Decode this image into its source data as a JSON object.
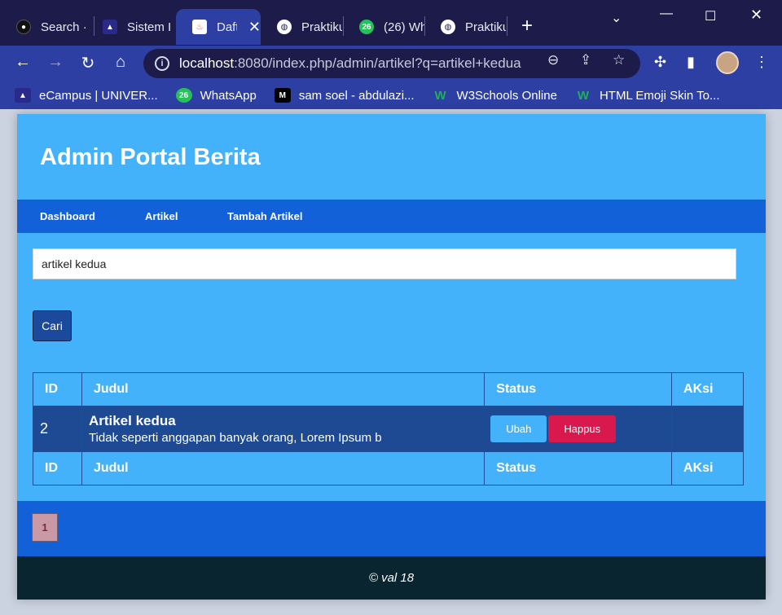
{
  "browser": {
    "tabs": [
      {
        "title": "Search ·",
        "icon": "github-icon"
      },
      {
        "title": "Sistem I",
        "icon": "campus-icon"
      },
      {
        "title": "Daft",
        "icon": "codeigniter-icon",
        "active": true
      },
      {
        "title": "Praktiku",
        "icon": "globe-icon"
      },
      {
        "title": "(26) Wh",
        "icon": "whatsapp-icon",
        "badge": "26"
      },
      {
        "title": "Praktiku",
        "icon": "globe-icon"
      }
    ],
    "tab_close": "✕",
    "new_tab": "+",
    "url_host": "localhost",
    "url_rest": ":8080/index.php/admin/artikel?q=artikel+kedua",
    "bookmarks": [
      {
        "label": "eCampus | UNIVER...",
        "icon": "campus-icon"
      },
      {
        "label": "WhatsApp",
        "icon": "whatsapp-icon",
        "badge": "26"
      },
      {
        "label": "sam soel - abdulazi...",
        "icon": "medium-icon"
      },
      {
        "label": "W3Schools Online",
        "icon": "w3schools-icon"
      },
      {
        "label": "HTML Emoji Skin To...",
        "icon": "w3schools-icon"
      }
    ]
  },
  "page": {
    "header_title": "Admin Portal Berita",
    "nav": [
      "Dashboard",
      "Artikel",
      "Tambah Artikel"
    ],
    "search": {
      "value": "artikel kedua"
    },
    "search_button": "Cari",
    "table": {
      "headers": [
        "ID",
        "Judul",
        "Status",
        "AKsi"
      ],
      "rows": [
        {
          "id": "2",
          "title": "Artikel kedua",
          "snippet": "Tidak seperti anggapan banyak orang, Lorem Ipsum b",
          "edit_label": "Ubah",
          "delete_label": "Happus"
        }
      ]
    },
    "pagination": [
      "1"
    ],
    "footer": "© val 18"
  },
  "colors": {
    "page_bg": "#44b2fa",
    "nav_bg": "#1261d8",
    "row_bg": "#1e4a93",
    "button_primary": "#1b4a9c",
    "button_delete": "#d9184e",
    "footer_bg": "#082530"
  }
}
